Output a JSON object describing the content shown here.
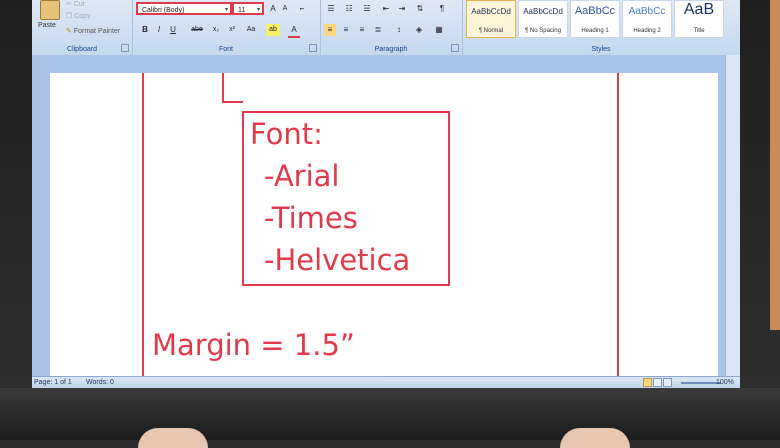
{
  "ribbon": {
    "clipboard": {
      "paste_label": "Paste",
      "cut_label": "Cut",
      "copy_label": "Copy",
      "format_painter_label": "Format Painter",
      "group_label": "Clipboard"
    },
    "font": {
      "font_name": "Calibri (Body)",
      "font_size": "11",
      "grow_label": "A",
      "shrink_label": "A",
      "clear_label": "⌐",
      "bold_label": "B",
      "italic_label": "I",
      "underline_label": "U",
      "strike_label": "abe",
      "subscript_label": "x₂",
      "superscript_label": "x²",
      "case_label": "Aa",
      "highlight_label": "ab",
      "color_label": "A",
      "group_label": "Font"
    },
    "paragraph": {
      "pilcrow_label": "¶",
      "group_label": "Paragraph"
    },
    "styles": {
      "items": [
        {
          "sample": "AaBbCcDd",
          "name": "¶ Normal"
        },
        {
          "sample": "AaBbCcDd",
          "name": "¶ No Spacing"
        },
        {
          "sample": "AaBbCc",
          "name": "Heading 1"
        },
        {
          "sample": "AaBbCc",
          "name": "Heading 2"
        },
        {
          "sample": "AaB",
          "name": "Title"
        }
      ],
      "group_label": "Styles"
    }
  },
  "annotation": {
    "heading": "Font:",
    "items": [
      "-Arial",
      "-Times",
      "-Helvetica"
    ],
    "margin_text": "Margin = 1.5”"
  },
  "statusbar": {
    "page": "Page: 1 of 1",
    "words": "Words: 0",
    "zoom": "100%"
  },
  "colors": {
    "annotation_red": "#e23a4d",
    "ribbon_blue": "#c5d8ee",
    "workspace_blue": "#a9c4e6"
  }
}
